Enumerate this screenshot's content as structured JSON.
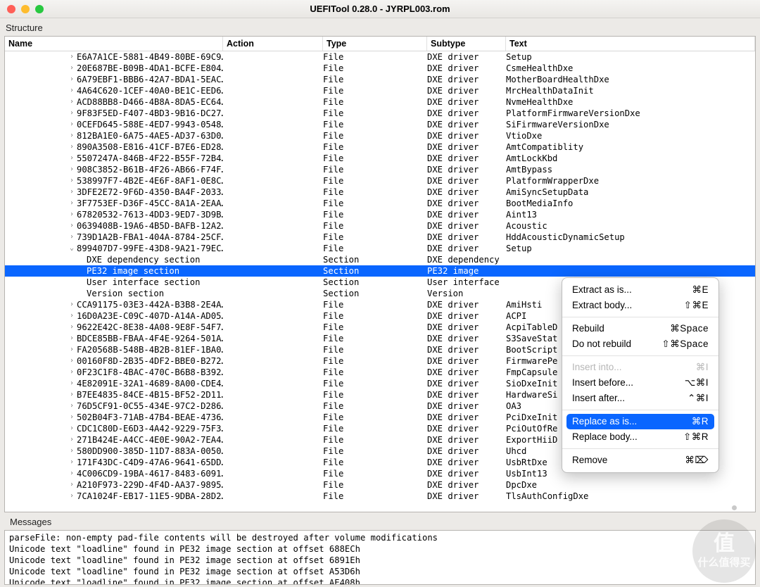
{
  "window": {
    "title": "UEFITool 0.28.0 - JYRPL003.rom"
  },
  "labels": {
    "structure": "Structure",
    "messages": "Messages"
  },
  "columns": {
    "name": "Name",
    "action": "Action",
    "type": "Type",
    "subtype": "Subtype",
    "text": "Text"
  },
  "rows": [
    {
      "indent": 6,
      "arrow": ">",
      "name": "E6A7A1CE-5881-4B49-80BE-69C9…",
      "type": "File",
      "sub": "DXE driver",
      "text": "Setup"
    },
    {
      "indent": 6,
      "arrow": ">",
      "name": "20E687BE-B09B-4DA1-BCFE-E804…",
      "type": "File",
      "sub": "DXE driver",
      "text": "CsmeHealthDxe"
    },
    {
      "indent": 6,
      "arrow": ">",
      "name": "6A79EBF1-BBB6-42A7-BDA1-5EAC…",
      "type": "File",
      "sub": "DXE driver",
      "text": "MotherBoardHealthDxe"
    },
    {
      "indent": 6,
      "arrow": ">",
      "name": "4A64C620-1CEF-40A0-BE1C-EED6…",
      "type": "File",
      "sub": "DXE driver",
      "text": "MrcHealthDataInit"
    },
    {
      "indent": 6,
      "arrow": ">",
      "name": "ACD88BB8-D466-4B8A-8DA5-EC64…",
      "type": "File",
      "sub": "DXE driver",
      "text": "NvmeHealthDxe"
    },
    {
      "indent": 6,
      "arrow": ">",
      "name": "9F83F5ED-F407-4BD3-9B16-DC27…",
      "type": "File",
      "sub": "DXE driver",
      "text": "PlatformFirmwareVersionDxe"
    },
    {
      "indent": 6,
      "arrow": ">",
      "name": "0CEFD645-588E-4ED7-9943-0548…",
      "type": "File",
      "sub": "DXE driver",
      "text": "SiFirmwareVersionDxe"
    },
    {
      "indent": 6,
      "arrow": ">",
      "name": "812BA1E0-6A75-4AE5-AD37-63D0…",
      "type": "File",
      "sub": "DXE driver",
      "text": "VtioDxe"
    },
    {
      "indent": 6,
      "arrow": ">",
      "name": "890A3508-E816-41CF-B7E6-ED28…",
      "type": "File",
      "sub": "DXE driver",
      "text": "AmtCompatiblity"
    },
    {
      "indent": 6,
      "arrow": ">",
      "name": "5507247A-846B-4F22-B55F-72B4…",
      "type": "File",
      "sub": "DXE driver",
      "text": "AmtLockKbd"
    },
    {
      "indent": 6,
      "arrow": ">",
      "name": "908C3852-B61B-4F26-AB66-F74F…",
      "type": "File",
      "sub": "DXE driver",
      "text": "AmtBypass"
    },
    {
      "indent": 6,
      "arrow": ">",
      "name": "538997F7-4B2E-4E6F-8AF1-0E8C…",
      "type": "File",
      "sub": "DXE driver",
      "text": "PlatformWrapperDxe"
    },
    {
      "indent": 6,
      "arrow": ">",
      "name": "3DFE2E72-9F6D-4350-BA4F-2033…",
      "type": "File",
      "sub": "DXE driver",
      "text": "AmiSyncSetupData"
    },
    {
      "indent": 6,
      "arrow": ">",
      "name": "3F7753EF-D36F-45CC-8A1A-2EAA…",
      "type": "File",
      "sub": "DXE driver",
      "text": "BootMediaInfo"
    },
    {
      "indent": 6,
      "arrow": ">",
      "name": "67820532-7613-4DD3-9ED7-3D9B…",
      "type": "File",
      "sub": "DXE driver",
      "text": "Aint13"
    },
    {
      "indent": 6,
      "arrow": ">",
      "name": "0639408B-19A6-4B5D-BAFB-12A2…",
      "type": "File",
      "sub": "DXE driver",
      "text": "Acoustic"
    },
    {
      "indent": 6,
      "arrow": ">",
      "name": "739D1A2B-FBA1-404A-8784-25CF…",
      "type": "File",
      "sub": "DXE driver",
      "text": "HddAcousticDynamicSetup"
    },
    {
      "indent": 6,
      "arrow": "v",
      "name": "899407D7-99FE-43D8-9A21-79EC…",
      "type": "File",
      "sub": "DXE driver",
      "text": "Setup"
    },
    {
      "indent": 7,
      "arrow": "",
      "name": "DXE dependency section",
      "type": "Section",
      "sub": "DXE dependency",
      "text": ""
    },
    {
      "indent": 7,
      "arrow": "",
      "name": "PE32 image section",
      "type": "Section",
      "sub": "PE32 image",
      "text": "",
      "selected": true
    },
    {
      "indent": 7,
      "arrow": "",
      "name": "User interface section",
      "type": "Section",
      "sub": "User interface",
      "text": ""
    },
    {
      "indent": 7,
      "arrow": "",
      "name": "Version section",
      "type": "Section",
      "sub": "Version",
      "text": ""
    },
    {
      "indent": 6,
      "arrow": ">",
      "name": "CCA91175-03E3-442A-B3B8-2E4A…",
      "type": "File",
      "sub": "DXE driver",
      "text": "AmiHsti"
    },
    {
      "indent": 6,
      "arrow": ">",
      "name": "16D0A23E-C09C-407D-A14A-AD05…",
      "type": "File",
      "sub": "DXE driver",
      "text": "ACPI"
    },
    {
      "indent": 6,
      "arrow": ">",
      "name": "9622E42C-8E38-4A08-9E8F-54F7…",
      "type": "File",
      "sub": "DXE driver",
      "text": "AcpiTableD"
    },
    {
      "indent": 6,
      "arrow": ">",
      "name": "BDCE85BB-FBAA-4F4E-9264-501A…",
      "type": "File",
      "sub": "DXE driver",
      "text": "S3SaveStat"
    },
    {
      "indent": 6,
      "arrow": ">",
      "name": "FA20568B-548B-4B2B-81EF-1BA0…",
      "type": "File",
      "sub": "DXE driver",
      "text": "BootScript"
    },
    {
      "indent": 6,
      "arrow": ">",
      "name": "00160F8D-2B35-4DF2-BBE0-B272…",
      "type": "File",
      "sub": "DXE driver",
      "text": "FirmwarePe"
    },
    {
      "indent": 6,
      "arrow": ">",
      "name": "0F23C1F8-4BAC-470C-B6B8-B392…",
      "type": "File",
      "sub": "DXE driver",
      "text": "FmpCapsule"
    },
    {
      "indent": 6,
      "arrow": ">",
      "name": "4E82091E-32A1-4689-8A00-CDE4…",
      "type": "File",
      "sub": "DXE driver",
      "text": "SioDxeInit"
    },
    {
      "indent": 6,
      "arrow": ">",
      "name": "B7EE4835-84CE-4B15-BF52-2D11…",
      "type": "File",
      "sub": "DXE driver",
      "text": "HardwareSi"
    },
    {
      "indent": 6,
      "arrow": ">",
      "name": "76D5CF91-0C55-434E-97C2-D286…",
      "type": "File",
      "sub": "DXE driver",
      "text": "OA3"
    },
    {
      "indent": 6,
      "arrow": ">",
      "name": "502B04F3-71AB-47B4-BEAE-4736…",
      "type": "File",
      "sub": "DXE driver",
      "text": "PciDxeInit"
    },
    {
      "indent": 6,
      "arrow": ">",
      "name": "CDC1C80D-E6D3-4A42-9229-75F3…",
      "type": "File",
      "sub": "DXE driver",
      "text": "PciOutOfRe"
    },
    {
      "indent": 6,
      "arrow": ">",
      "name": "271B424E-A4CC-4E0E-90A2-7EA4…",
      "type": "File",
      "sub": "DXE driver",
      "text": "ExportHiiD"
    },
    {
      "indent": 6,
      "arrow": ">",
      "name": "580DD900-385D-11D7-883A-0050…",
      "type": "File",
      "sub": "DXE driver",
      "text": "Uhcd"
    },
    {
      "indent": 6,
      "arrow": ">",
      "name": "171F43DC-C4D9-47A6-9641-65DD…",
      "type": "File",
      "sub": "DXE driver",
      "text": "UsbRtDxe"
    },
    {
      "indent": 6,
      "arrow": ">",
      "name": "4C006CD9-19BA-4617-8483-6091…",
      "type": "File",
      "sub": "DXE driver",
      "text": "UsbInt13"
    },
    {
      "indent": 6,
      "arrow": ">",
      "name": "A210F973-229D-4F4D-AA37-9895…",
      "type": "File",
      "sub": "DXE driver",
      "text": "DpcDxe"
    },
    {
      "indent": 6,
      "arrow": ">",
      "name": "7CA1024F-EB17-11E5-9DBA-28D2…",
      "type": "File",
      "sub": "DXE driver",
      "text": "TlsAuthConfigDxe"
    }
  ],
  "context_menu": {
    "items": [
      {
        "label": "Extract as is...",
        "sc": "⌘E"
      },
      {
        "label": "Extract body...",
        "sc": "⇧⌘E"
      },
      {
        "sep": true
      },
      {
        "label": "Rebuild",
        "sc": "⌘Space"
      },
      {
        "label": "Do not rebuild",
        "sc": "⇧⌘Space"
      },
      {
        "sep": true
      },
      {
        "label": "Insert into...",
        "sc": "⌘I",
        "disabled": true
      },
      {
        "label": "Insert before...",
        "sc": "⌥⌘I"
      },
      {
        "label": "Insert after...",
        "sc": "⌃⌘I"
      },
      {
        "sep": true
      },
      {
        "label": "Replace as is...",
        "sc": "⌘R",
        "hl": true
      },
      {
        "label": "Replace body...",
        "sc": "⇧⌘R"
      },
      {
        "sep": true
      },
      {
        "label": "Remove",
        "sc": "⌘⌦"
      }
    ]
  },
  "messages": [
    "parseFile: non-empty pad-file contents will be destroyed after volume modifications",
    "Unicode text \"loadline\" found in PE32 image section at offset 688ECh",
    "Unicode text \"loadline\" found in PE32 image section at offset 6891Eh",
    "Unicode text \"loadline\" found in PE32 image section at offset A53D6h",
    "Unicode text \"loadline\" found in PE32 image section at offset AE408h"
  ],
  "watermark": {
    "top": "值",
    "bottom": "什么值得买"
  }
}
